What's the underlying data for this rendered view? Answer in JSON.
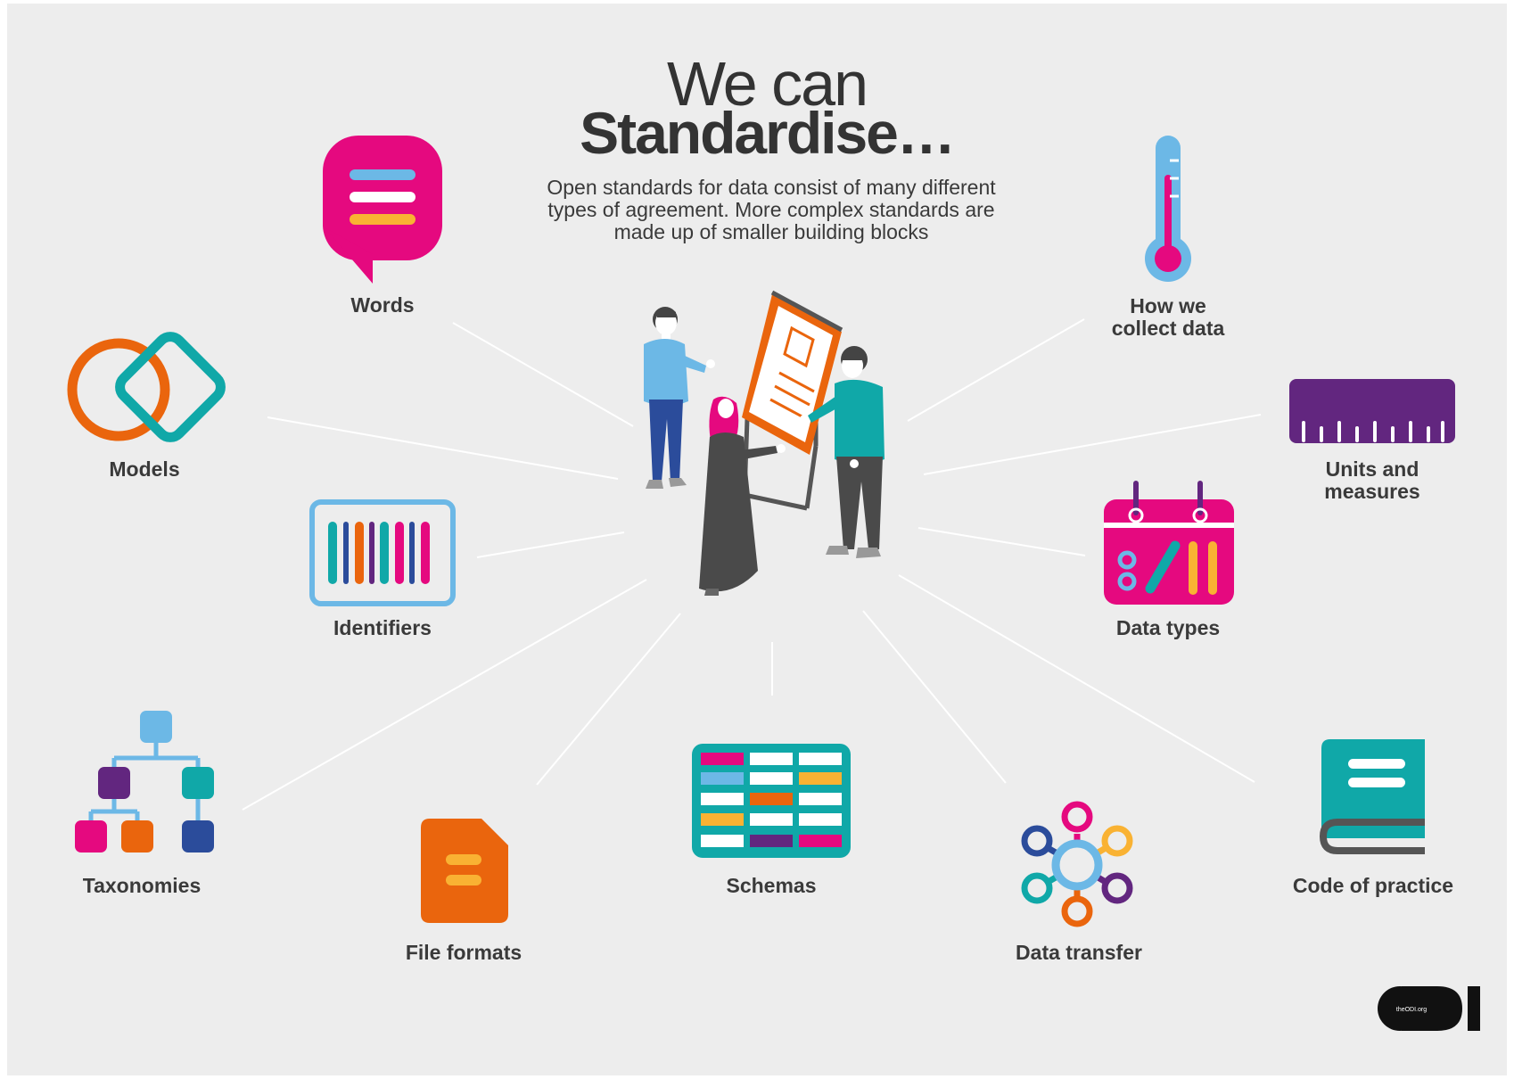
{
  "heading": {
    "line1": "We can",
    "line2": "Standardise…",
    "subtitle": "Open standards for data consist of many different types of agreement. More complex standards are made up of smaller building blocks"
  },
  "blocks": [
    {
      "id": "words",
      "label": "Words"
    },
    {
      "id": "models",
      "label": "Models"
    },
    {
      "id": "identifiers",
      "label": "Identifiers"
    },
    {
      "id": "taxonomies",
      "label": "Taxonomies"
    },
    {
      "id": "file-formats",
      "label": "File formats"
    },
    {
      "id": "schemas",
      "label": "Schemas"
    },
    {
      "id": "data-transfer",
      "label": "Data transfer"
    },
    {
      "id": "code-of-practice",
      "label": "Code of practice"
    },
    {
      "id": "data-types",
      "label": "Data types"
    },
    {
      "id": "units-and-measures",
      "label": "Units and measures"
    },
    {
      "id": "how-we-collect-data",
      "label": "How we collect data"
    }
  ],
  "logo": {
    "mark": "ODI",
    "url_text": "theODI.org"
  },
  "colors": {
    "background": "#ededed",
    "pink": "#e5097f",
    "orange": "#ea650d",
    "teal": "#10a8a8",
    "sky": "#6cb8e6",
    "purple": "#62267f",
    "yellow": "#f9b233",
    "navy": "#2b4c9b",
    "dark": "#333333"
  }
}
